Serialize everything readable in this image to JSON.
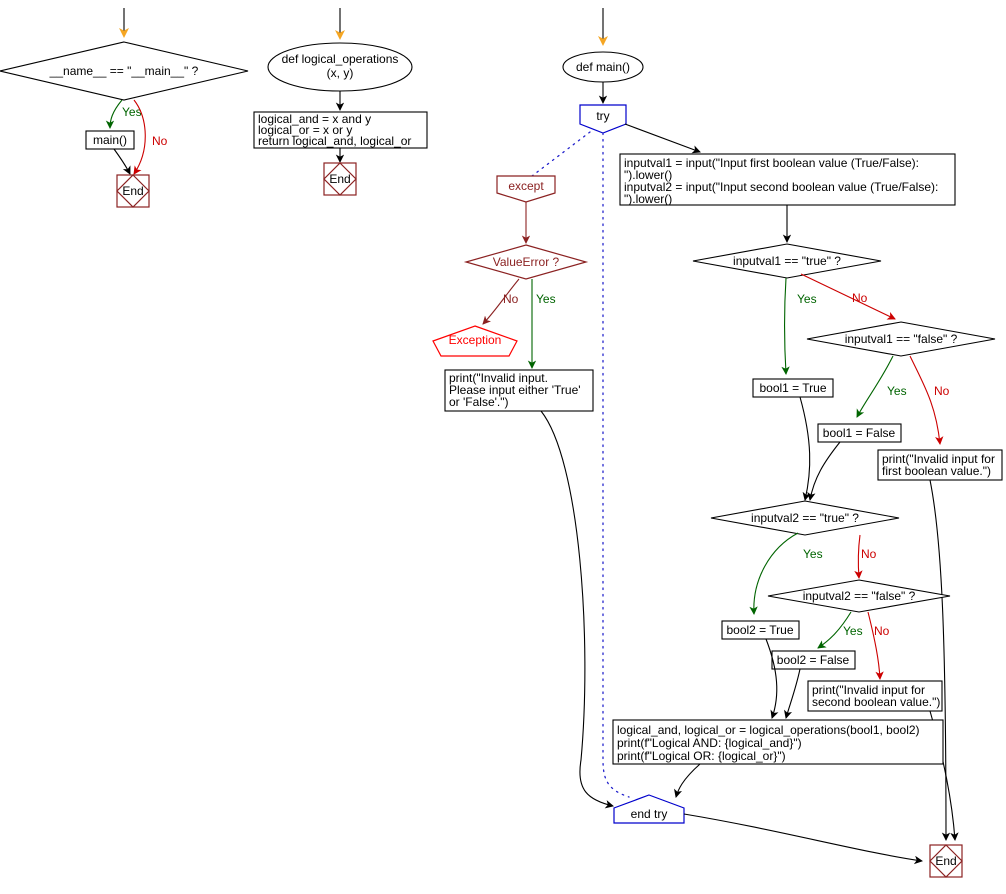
{
  "diagram": {
    "title": "Python flowchart: logical operations on two boolean inputs",
    "colors": {
      "yes": "#006400",
      "no": "#cc0000",
      "try_blue": "#0000cc",
      "except_dark_red": "#8b2222",
      "exception_red": "#ff0000",
      "start_arrow_orange": "#f5a623",
      "default": "#000000"
    },
    "edge_labels": {
      "yes": "Yes",
      "no": "No"
    },
    "nodes": {
      "main_guard": "__name__ == \"__main__\" ?",
      "call_main": "main()",
      "end_left": "End",
      "def_logical_operations": "def logical_operations\n(x, y)",
      "logical_body": "logical_and = x and y\nlogical_or = x or y\nreturn logical_and, logical_or",
      "end_middle": "End",
      "def_main": "def main()",
      "try": "try",
      "except": "except",
      "value_error": "ValueError ?",
      "exception": "Exception",
      "print_invalid_input": "print(\"Invalid input.\nPlease input either 'True'\nor 'False'.\")",
      "inputs": "inputval1 = input(\"Input first boolean value (True/False):\n\").lower()\ninputval2 = input(\"Input second boolean value (True/False):\n\").lower()",
      "inputval1_true": "inputval1 == \"true\" ?",
      "inputval1_false": "inputval1 == \"false\" ?",
      "bool1_true": "bool1 = True",
      "bool1_false": "bool1 = False",
      "print_invalid_first": "print(\"Invalid input for\nfirst boolean value.\")",
      "inputval2_true": "inputval2 == \"true\" ?",
      "inputval2_false": "inputval2 == \"false\" ?",
      "bool2_true": "bool2 = True",
      "bool2_false": "bool2 = False",
      "print_invalid_second": "print(\"Invalid input for\nsecond boolean value.\")",
      "call_block": "logical_and, logical_or = logical_operations(bool1, bool2)\nprint(f\"Logical AND: {logical_and}\")\nprint(f\"Logical OR: {logical_or}\")",
      "end_try": "end try",
      "end_right": "End"
    },
    "text_lines": {
      "def_logical_operations": [
        "def logical_operations",
        "(x, y)"
      ],
      "logical_body": [
        "logical_and = x and y",
        "logical_or = x or y",
        "return logical_and, logical_or"
      ],
      "print_invalid_input": [
        "print(\"Invalid input.",
        "Please input either 'True'",
        "or 'False'.\")"
      ],
      "inputs": [
        "inputval1 = input(\"Input first boolean value (True/False):",
        "\").lower()",
        "inputval2 = input(\"Input second boolean value (True/False):",
        "\").lower()"
      ],
      "print_invalid_first": [
        "print(\"Invalid input for",
        "first boolean value.\")"
      ],
      "print_invalid_second": [
        "print(\"Invalid input for",
        "second boolean value.\")"
      ],
      "call_block": [
        "logical_and, logical_or = logical_operations(bool1, bool2)",
        "print(f\"Logical AND: {logical_and}\")",
        "print(f\"Logical OR: {logical_or}\")"
      ]
    }
  }
}
